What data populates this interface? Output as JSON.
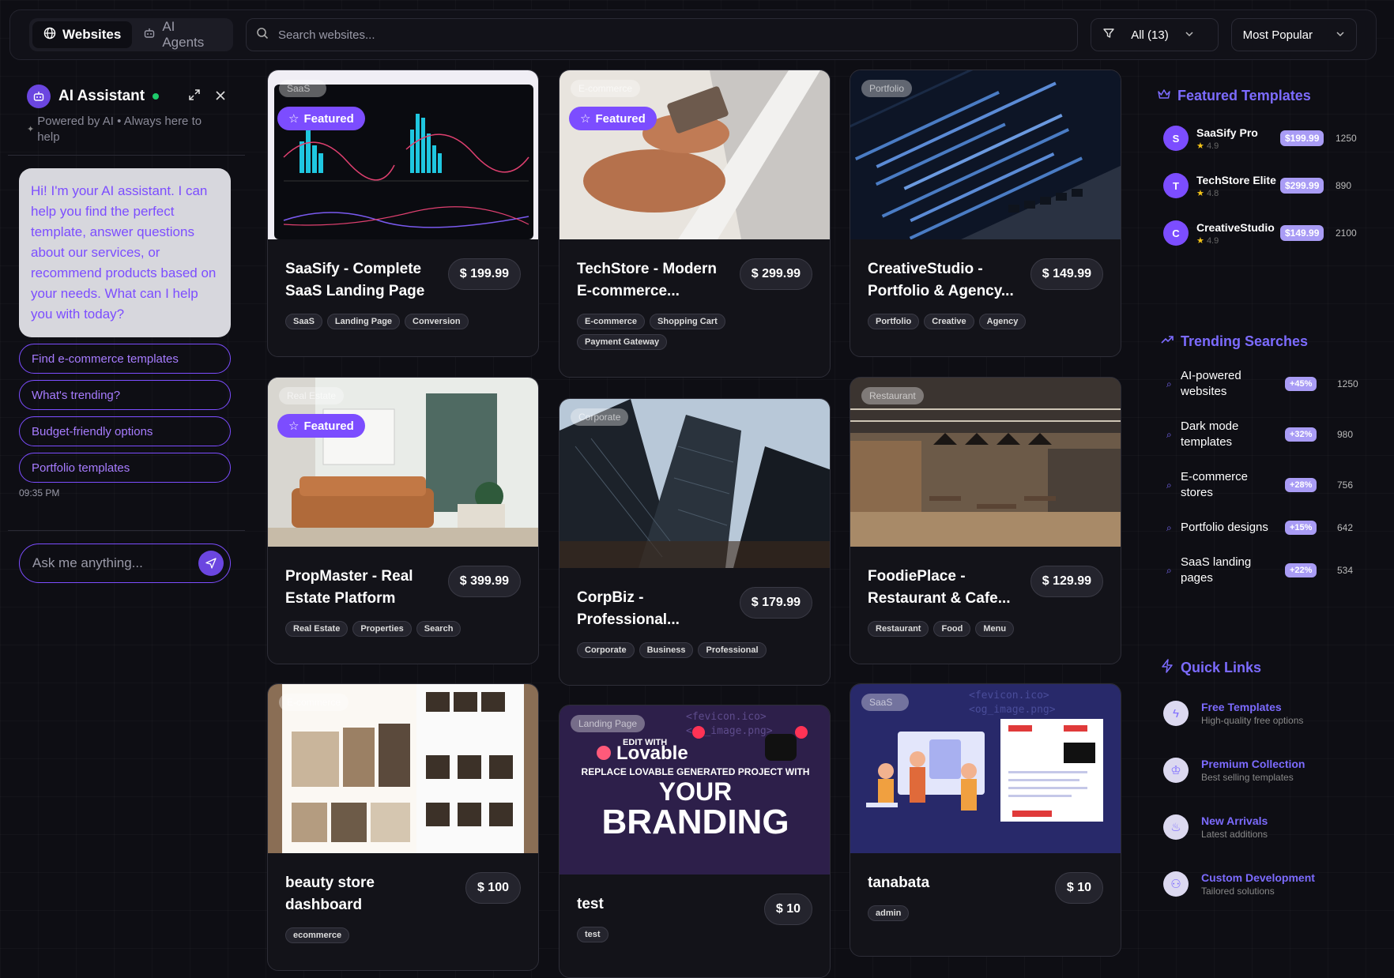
{
  "topbar": {
    "tabs": [
      {
        "label": "Websites",
        "active": true
      },
      {
        "label": "AI Agents",
        "active": false
      }
    ],
    "search_placeholder": "Search websites...",
    "filter_label": "All (13)",
    "sort_label": "Most Popular"
  },
  "assistant": {
    "title": "AI Assistant",
    "subtitle": "Powered by AI • Always here to help",
    "message": "Hi! I'm your AI assistant. I can help you find the perfect template, answer questions about our services, or recommend products based on your needs. What can I help you with today?",
    "suggestions": [
      "Find e-commerce templates",
      "What's trending?",
      "Budget-friendly options",
      "Portfolio templates"
    ],
    "time": "09:35 PM",
    "input_placeholder": "Ask me anything..."
  },
  "cards": [
    {
      "category": "SaaS",
      "featured": true,
      "featured_label": "Featured",
      "title": "SaaSify - Complete SaaS Landing Page",
      "price": "$ 199.99",
      "tags": [
        "SaaS",
        "Landing Page",
        "Conversion"
      ]
    },
    {
      "category": "E-commerce",
      "featured": true,
      "featured_label": "Featured",
      "title": "TechStore - Modern E-commerce...",
      "price": "$ 299.99",
      "tags": [
        "E-commerce",
        "Shopping Cart",
        "Payment Gateway"
      ]
    },
    {
      "category": "Portfolio",
      "featured": false,
      "title": "CreativeStudio - Portfolio & Agency...",
      "price": "$ 149.99",
      "tags": [
        "Portfolio",
        "Creative",
        "Agency"
      ]
    },
    {
      "category": "Real Estate",
      "featured": true,
      "featured_label": "Featured",
      "title": "PropMaster - Real Estate Platform",
      "price": "$ 399.99",
      "tags": [
        "Real Estate",
        "Properties",
        "Search"
      ]
    },
    {
      "category": "Corporate",
      "featured": false,
      "title": "CorpBiz - Professional...",
      "price": "$ 179.99",
      "tags": [
        "Corporate",
        "Business",
        "Professional"
      ]
    },
    {
      "category": "Restaurant",
      "featured": false,
      "title": "FoodiePlace - Restaurant & Cafe...",
      "price": "$ 129.99",
      "tags": [
        "Restaurant",
        "Food",
        "Menu"
      ]
    },
    {
      "category": "E-commerce",
      "featured": false,
      "title": "beauty store dashboard",
      "price": "$ 100",
      "tags": [
        "ecommerce"
      ]
    },
    {
      "category": "Landing Page",
      "featured": false,
      "title": "test",
      "price": "$ 10",
      "tags": [
        "test"
      ]
    },
    {
      "category": "SaaS",
      "featured": false,
      "title": "tanabata",
      "price": "$ 10",
      "tags": [
        "admin"
      ]
    }
  ],
  "featured_templates": {
    "heading": "Featured Templates",
    "items": [
      {
        "initial": "S",
        "name": "SaaSify Pro",
        "rating": "4.9",
        "price": "$199.99",
        "count": "1250"
      },
      {
        "initial": "T",
        "name": "TechStore Elite",
        "rating": "4.8",
        "price": "$299.99",
        "count": "890"
      },
      {
        "initial": "C",
        "name": "CreativeStudio",
        "rating": "4.9",
        "price": "$149.99",
        "count": "2100"
      }
    ]
  },
  "trending": {
    "heading": "Trending Searches",
    "items": [
      {
        "label": "AI-powered websites",
        "pct": "+45%",
        "count": "1250"
      },
      {
        "label": "Dark mode templates",
        "pct": "+32%",
        "count": "980"
      },
      {
        "label": "E-commerce stores",
        "pct": "+28%",
        "count": "756"
      },
      {
        "label": "Portfolio designs",
        "pct": "+15%",
        "count": "642"
      },
      {
        "label": "SaaS landing pages",
        "pct": "+22%",
        "count": "534"
      }
    ]
  },
  "quick_links": {
    "heading": "Quick Links",
    "items": [
      {
        "title": "Free Templates",
        "sub": "High-quality free options",
        "icon": "bolt-icon"
      },
      {
        "title": "Premium Collection",
        "sub": "Best selling templates",
        "icon": "crown-icon"
      },
      {
        "title": "New Arrivals",
        "sub": "Latest additions",
        "icon": "flame-icon"
      },
      {
        "title": "Custom Development",
        "sub": "Tailored solutions",
        "icon": "users-icon"
      }
    ]
  },
  "colors": {
    "accent": "#7c4dff",
    "background": "#0e0e14"
  },
  "thumbnail_art": {
    "sm": "EDIT WITH",
    "brand": "Lovable",
    "line": "REPLACE LOVABLE GENERATED PROJECT WITH",
    "your": "YOUR",
    "branding": "BRANDING",
    "code1": "<fevicon.ico>",
    "code2": "<og_image.png>"
  }
}
